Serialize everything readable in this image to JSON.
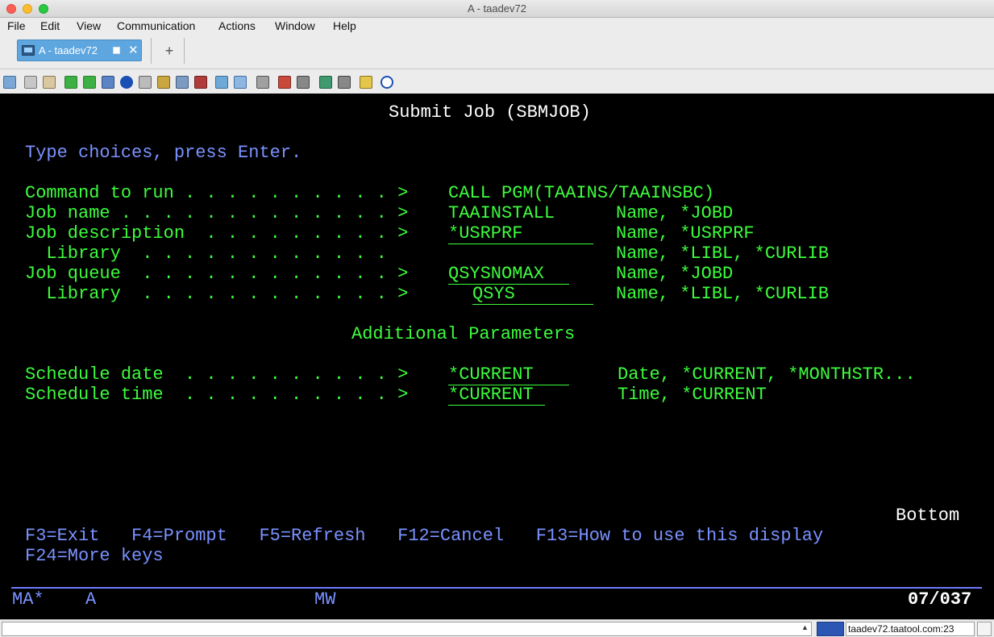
{
  "window": {
    "title": "A - taadev72"
  },
  "menu": [
    "File",
    "Edit",
    "View",
    "Communication",
    "Actions",
    "Window",
    "Help"
  ],
  "tabs": [
    {
      "label": "A - taadev72"
    }
  ],
  "toolbar_icons": [
    "copy-icon",
    "copy-append-icon",
    "paste-icon",
    "upload-icon",
    "download-icon",
    "print-screen-icon",
    "navigator-icon",
    "file-transfer-icon",
    "open-folder-icon",
    "settings-icon",
    "spooled-file-icon",
    "data-icon",
    "grid-icon",
    "tools-icon",
    "record-macro-icon",
    "stop-macro-icon",
    "play-macro-icon",
    "pause-macro-icon",
    "notes-icon",
    "help-icon"
  ],
  "screen": {
    "title": "Submit Job (SBMJOB)",
    "instruction": "Type choices, press Enter.",
    "rows": [
      {
        "label": "Command to run . . . . . . . . . . >",
        "value": "CALL PGM(TAAINS/TAAINSBC)",
        "hint": ""
      },
      {
        "label": "Job name . . . . . . . . . . . . . >",
        "value": "TAAINSTALL",
        "hint": "Name, *JOBD"
      },
      {
        "label": "Job description  . . . . . . . . . >",
        "value": "*USRPRF",
        "hint": "Name, *USRPRF"
      },
      {
        "label": "  Library  . . . . . . . . . . . .",
        "value": "",
        "hint": "Name, *LIBL, *CURLIB"
      },
      {
        "label": "Job queue  . . . . . . . . . . . . >",
        "value": "QSYSNOMAX",
        "hint": "Name, *JOBD"
      },
      {
        "label": "  Library  . . . . . . . . . . . . >",
        "value": "QSYS",
        "hint": "Name, *LIBL, *CURLIB"
      }
    ],
    "section_title": "Additional Parameters",
    "rows2": [
      {
        "label": "Schedule date  . . . . . . . . . . >",
        "value": "*CURRENT",
        "hint": "Date, *CURRENT, *MONTHSTR..."
      },
      {
        "label": "Schedule time  . . . . . . . . . . >",
        "value": "*CURRENT",
        "hint": "Time, *CURRENT"
      }
    ],
    "bottom": "Bottom",
    "fkeys1": "F3=Exit   F4=Prompt   F5=Refresh   F12=Cancel   F13=How to use this display",
    "fkeys2": "F24=More keys",
    "oia": {
      "left": "MA*",
      "session": "A",
      "mode": "MW",
      "cursor_pos": "07/037"
    }
  },
  "status": {
    "host": "taadev72.taatool.com:23"
  }
}
